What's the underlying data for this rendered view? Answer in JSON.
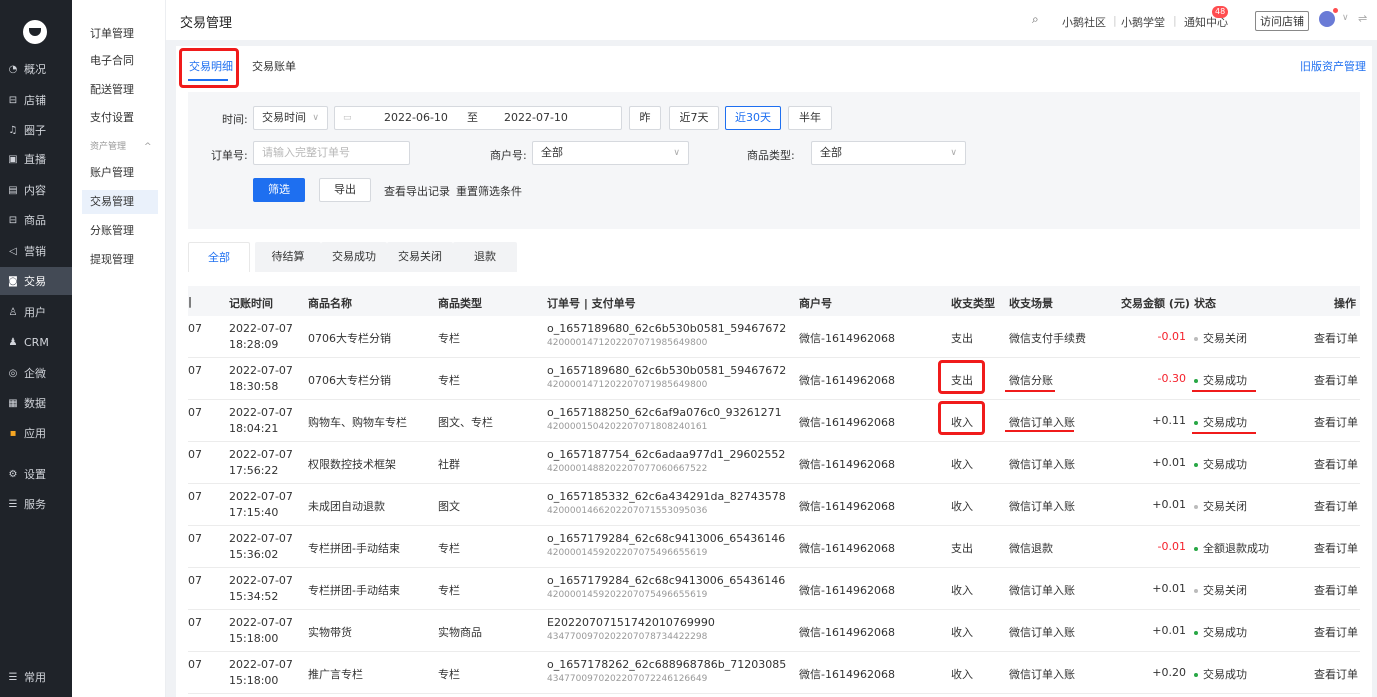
{
  "sidebar": {
    "items": [
      {
        "icon": "overview-icon",
        "glyph": "◔",
        "label": "概况"
      },
      {
        "icon": "store-icon",
        "glyph": "⊟",
        "label": "店铺"
      },
      {
        "icon": "circle-icon",
        "glyph": "♫",
        "label": "圈子"
      },
      {
        "icon": "live-icon",
        "glyph": "▣",
        "label": "直播"
      },
      {
        "icon": "content-icon",
        "glyph": "▤",
        "label": "内容"
      },
      {
        "icon": "goods-icon",
        "glyph": "⊟",
        "label": "商品"
      },
      {
        "icon": "marketing-icon",
        "glyph": "◁",
        "label": "营销"
      },
      {
        "icon": "trade-icon",
        "glyph": "◙",
        "label": "交易"
      },
      {
        "icon": "user-icon",
        "glyph": "♙",
        "label": "用户"
      },
      {
        "icon": "crm-icon",
        "glyph": "♟",
        "label": "CRM"
      },
      {
        "icon": "wecom-icon",
        "glyph": "◎",
        "label": "企微"
      },
      {
        "icon": "data-icon",
        "glyph": "▦",
        "label": "数据"
      },
      {
        "icon": "apps-icon",
        "glyph": "▪",
        "label": "应用"
      },
      {
        "icon": "settings-icon",
        "glyph": "⚙",
        "label": "设置"
      },
      {
        "icon": "service-icon",
        "glyph": "☰",
        "label": "服务"
      }
    ],
    "active_index": 7,
    "bottom": {
      "icon": "menu-icon",
      "glyph": "☰",
      "label": "常用"
    }
  },
  "submenu": {
    "items": [
      "订单管理",
      "电子合同",
      "配送管理",
      "支付设置",
      "资产管理",
      "账户管理",
      "交易管理",
      "分账管理",
      "提现管理"
    ],
    "group_chevron": "^"
  },
  "topbar": {
    "title": "交易管理",
    "links": [
      "小鹅社区",
      "小鹅学堂",
      "通知中心"
    ],
    "badge": "48",
    "visit_store": "访问店铺"
  },
  "tabs": {
    "detail": "交易明细",
    "bill": "交易账单",
    "old_link": "旧版资产管理"
  },
  "filter": {
    "time_label": "时间:",
    "time_type": "交易时间",
    "date_start": "2022-06-10",
    "date_to": "至",
    "date_end": "2022-07-10",
    "quick": [
      "昨",
      "近7天",
      "近30天",
      "半年"
    ],
    "quick_selected": 2,
    "order_label": "订单号:",
    "order_placeholder": "请输入完整订单号",
    "merchant_label": "商户号:",
    "merchant_value": "全部",
    "goods_type_label": "商品类型:",
    "goods_type_value": "全部",
    "filter_btn": "筛选",
    "export_btn": "导出",
    "export_record": "查看导出记录",
    "reset": "重置筛选条件"
  },
  "status_tabs": [
    "全部",
    "待结算",
    "交易成功",
    "交易关闭",
    "退款"
  ],
  "table": {
    "headers": {
      "time": "记账时间",
      "name": "商品名称",
      "type": "商品类型",
      "order": "订单号 | 支付单号",
      "merchant": "商户号",
      "io_type": "收支类型",
      "scene": "收支场景",
      "amount": "交易金额 (元)",
      "status": "状态",
      "op": "操作"
    },
    "rows": [
      {
        "lead": "07",
        "date": "2022-07-07",
        "time": "18:28:09",
        "name": "0706大专栏分销",
        "type": "专栏",
        "order": "o_1657189680_62c6b530b0581_59467672",
        "pay": "4200001471202207071985649800",
        "merchant": "微信-1614962068",
        "io": "支出",
        "scene": "微信支付手续费",
        "amount": "-0.01",
        "negative": true,
        "status": "交易关闭",
        "status_color": "gray",
        "op": "查看订单"
      },
      {
        "lead": "07",
        "date": "2022-07-07",
        "time": "18:30:58",
        "name": "0706大专栏分销",
        "type": "专栏",
        "order": "o_1657189680_62c6b530b0581_59467672",
        "pay": "4200001471202207071985649800",
        "merchant": "微信-1614962068",
        "io": "支出",
        "scene": "微信分账",
        "amount": "-0.30",
        "negative": true,
        "status": "交易成功",
        "status_color": "green",
        "op": "查看订单"
      },
      {
        "lead": "07",
        "date": "2022-07-07",
        "time": "18:04:21",
        "name": "购物车、购物车专栏",
        "type": "图文、专栏",
        "order": "o_1657188250_62c6af9a076c0_93261271",
        "pay": "4200001504202207071808240161",
        "merchant": "微信-1614962068",
        "io": "收入",
        "scene": "微信订单入账",
        "amount": "+0.11",
        "negative": false,
        "status": "交易成功",
        "status_color": "green",
        "op": "查看订单"
      },
      {
        "lead": "07",
        "date": "2022-07-07",
        "time": "17:56:22",
        "name": "权限数控技术框架",
        "type": "社群",
        "order": "o_1657187754_62c6adaa977d1_29602552",
        "pay": "4200001488202207077060667522",
        "merchant": "微信-1614962068",
        "io": "收入",
        "scene": "微信订单入账",
        "amount": "+0.01",
        "negative": false,
        "status": "交易成功",
        "status_color": "green",
        "op": "查看订单"
      },
      {
        "lead": "07",
        "date": "2022-07-07",
        "time": "17:15:40",
        "name": "未成团自动退款",
        "type": "图文",
        "order": "o_1657185332_62c6a434291da_82743578",
        "pay": "4200001466202207071553095036",
        "merchant": "微信-1614962068",
        "io": "收入",
        "scene": "微信订单入账",
        "amount": "+0.01",
        "negative": false,
        "status": "交易关闭",
        "status_color": "gray",
        "op": "查看订单"
      },
      {
        "lead": "07",
        "date": "2022-07-07",
        "time": "15:36:02",
        "name": "专栏拼团-手动结束",
        "type": "专栏",
        "order": "o_1657179284_62c68c9413006_65436146",
        "pay": "4200001459202207075496655619",
        "merchant": "微信-1614962068",
        "io": "支出",
        "scene": "微信退款",
        "amount": "-0.01",
        "negative": true,
        "status": "全额退款成功",
        "status_color": "green",
        "op": "查看订单"
      },
      {
        "lead": "07",
        "date": "2022-07-07",
        "time": "15:34:52",
        "name": "专栏拼团-手动结束",
        "type": "专栏",
        "order": "o_1657179284_62c68c9413006_65436146",
        "pay": "4200001459202207075496655619",
        "merchant": "微信-1614962068",
        "io": "收入",
        "scene": "微信订单入账",
        "amount": "+0.01",
        "negative": false,
        "status": "交易关闭",
        "status_color": "gray",
        "op": "查看订单"
      },
      {
        "lead": "07",
        "date": "2022-07-07",
        "time": "15:18:00",
        "name": "实物带货",
        "type": "实物商品",
        "order": "E20220707151742010769990",
        "pay": "4347700970202207078734422298",
        "merchant": "微信-1614962068",
        "io": "收入",
        "scene": "微信订单入账",
        "amount": "+0.01",
        "negative": false,
        "status": "交易成功",
        "status_color": "green",
        "op": "查看订单"
      },
      {
        "lead": "07",
        "date": "2022-07-07",
        "time": "15:18:00",
        "name": "推广言专栏",
        "type": "专栏",
        "order": "o_1657178262_62c688968786b_71203085",
        "pay": "4347700970202207072246126649",
        "merchant": "微信-1614962068",
        "io": "收入",
        "scene": "微信订单入账",
        "amount": "+0.20",
        "negative": false,
        "status": "交易成功",
        "status_color": "green",
        "op": "查看订单"
      }
    ]
  },
  "colors": {
    "accent": "#1e6ff0",
    "annotation": "#f01b1b",
    "negative": "#f5222d",
    "success": "#28a745"
  }
}
